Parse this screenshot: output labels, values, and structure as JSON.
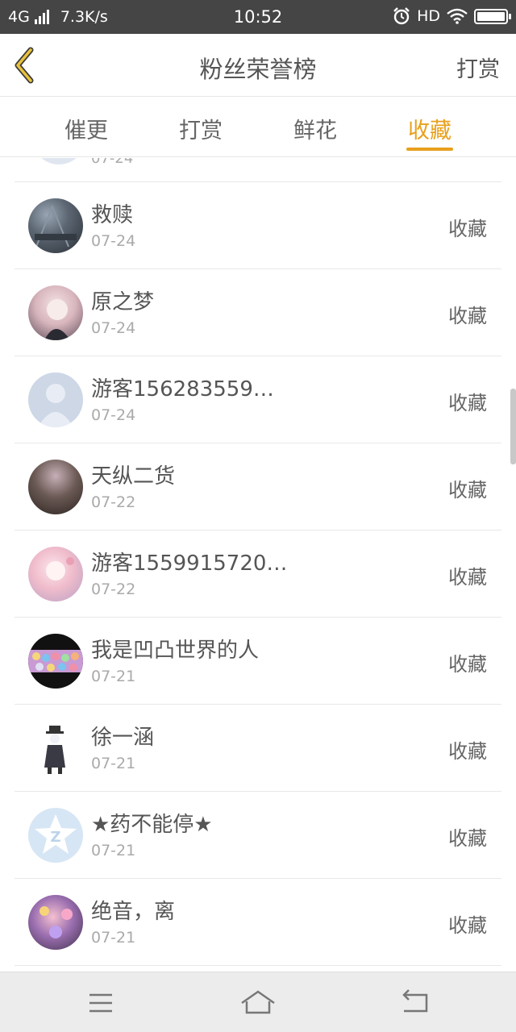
{
  "status_bar": {
    "network": "4G",
    "speed": "7.3K/s",
    "time": "10:52",
    "hd": "HD",
    "icons": [
      "signal-icon",
      "alarm-icon",
      "wifi-icon",
      "battery-icon"
    ],
    "battery_level": 1.0
  },
  "header": {
    "title": "粉丝荣誉榜",
    "action": "打赏",
    "back_icon": "chevron-left-icon"
  },
  "tabs": [
    {
      "label": "催更",
      "active": false
    },
    {
      "label": "打赏",
      "active": false
    },
    {
      "label": "鲜花",
      "active": false
    },
    {
      "label": "收藏",
      "active": true
    }
  ],
  "accent_color": "#e8a01c",
  "list": {
    "partial_date": "07-24",
    "rows": [
      {
        "name": "救赎",
        "date": "07-24",
        "action": "收藏",
        "avatar": "photo-avatar"
      },
      {
        "name": "原之梦",
        "date": "07-24",
        "action": "收藏",
        "avatar": "anime-avatar"
      },
      {
        "name": "游客156283559…",
        "date": "07-24",
        "action": "收藏",
        "avatar": "default-user-avatar"
      },
      {
        "name": "天纵二货",
        "date": "07-22",
        "action": "收藏",
        "avatar": "photo-avatar"
      },
      {
        "name": "游客1559915720…",
        "date": "07-22",
        "action": "收藏",
        "avatar": "anime-avatar"
      },
      {
        "name": "我是凹凸世界的人",
        "date": "07-21",
        "action": "收藏",
        "avatar": "anime-group-avatar"
      },
      {
        "name": "徐一涵",
        "date": "07-21",
        "action": "收藏",
        "avatar": "anime-character-avatar"
      },
      {
        "name": "★药不能停★",
        "date": "07-21",
        "action": "收藏",
        "avatar": "qq-logo-avatar"
      },
      {
        "name": "绝音，离",
        "date": "07-21",
        "action": "收藏",
        "avatar": "anime-avatar"
      }
    ]
  },
  "nav_bar": {
    "buttons": [
      "menu-icon",
      "home-icon",
      "back-icon"
    ]
  }
}
